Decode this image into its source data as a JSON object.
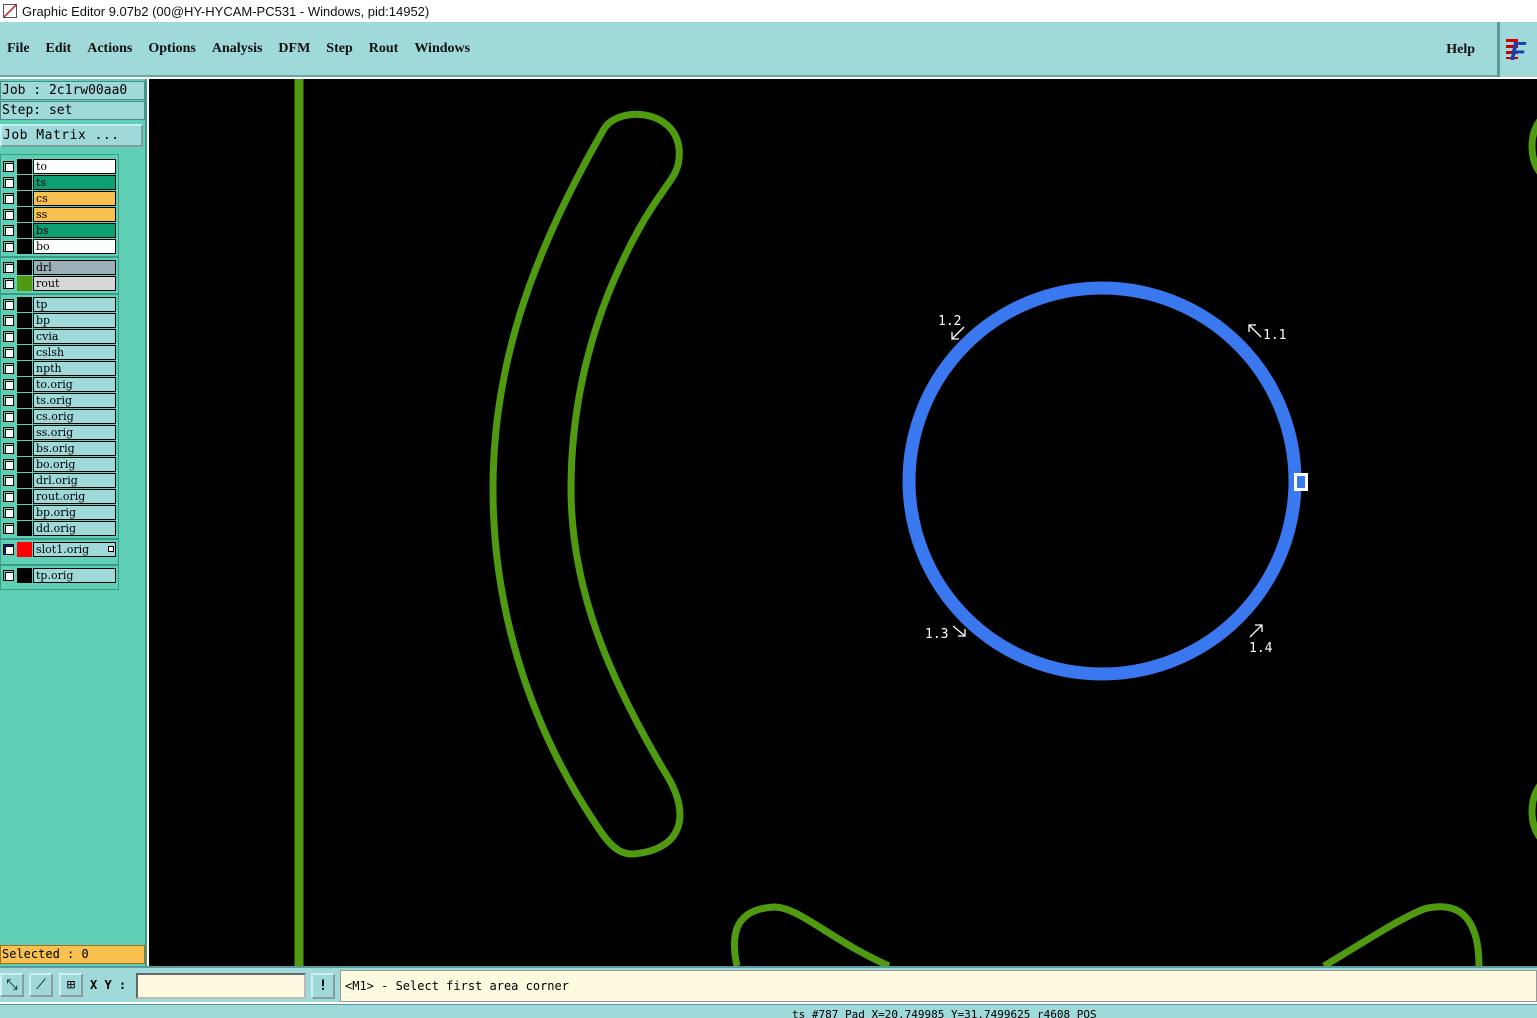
{
  "window": {
    "title": "Graphic Editor 9.07b2 (00@HY-HYCAM-PC531 - Windows, pid:14952)"
  },
  "menu": {
    "items": [
      "File",
      "Edit",
      "Actions",
      "Options",
      "Analysis",
      "DFM",
      "Step",
      "Rout",
      "Windows"
    ],
    "help": "Help"
  },
  "brand": {
    "logo_text": "F"
  },
  "job": {
    "job_line": "Job : 2c1rw00aa0",
    "step_line": "Step: set",
    "matrix_button": "Job Matrix ..."
  },
  "layers": [
    {
      "name": "to",
      "color": "#ffffff"
    },
    {
      "name": "ts",
      "color": "#0d9e72"
    },
    {
      "name": "cs",
      "color": "#f8c14f"
    },
    {
      "name": "ss",
      "color": "#f8c14f"
    },
    {
      "name": "bs",
      "color": "#0d9e72"
    },
    {
      "name": "bo",
      "color": "#ffffff"
    },
    {
      "name": "drl",
      "color": "#9cb0b8"
    },
    {
      "name": "rout",
      "color": "#d8d8d8",
      "swatch": "#4f9a10"
    },
    {
      "name": "tp",
      "color": "#9fd9d9"
    },
    {
      "name": "bp",
      "color": "#9fd9d9"
    },
    {
      "name": "cvia",
      "color": "#9fd9d9"
    },
    {
      "name": "cslsh",
      "color": "#9fd9d9"
    },
    {
      "name": "npth",
      "color": "#9fd9d9"
    },
    {
      "name": "to.orig",
      "color": "#9fd9d9"
    },
    {
      "name": "ts.orig",
      "color": "#9fd9d9"
    },
    {
      "name": "cs.orig",
      "color": "#9fd9d9"
    },
    {
      "name": "ss.orig",
      "color": "#9fd9d9"
    },
    {
      "name": "bs.orig",
      "color": "#9fd9d9"
    },
    {
      "name": "bo.orig",
      "color": "#9fd9d9"
    },
    {
      "name": "drl.orig",
      "color": "#9fd9d9"
    },
    {
      "name": "rout.orig",
      "color": "#9fd9d9"
    },
    {
      "name": "bp.orig",
      "color": "#9fd9d9"
    },
    {
      "name": "dd.orig",
      "color": "#9fd9d9"
    },
    {
      "name": "slot1.orig",
      "color": "#9fd9d9",
      "swatch": "#ff0000",
      "checkbox": "#0020a0",
      "has_indicator": true
    },
    {
      "name": "tp.orig",
      "color": "#9fd9d9"
    }
  ],
  "selection": {
    "label": "Selected : 0"
  },
  "canvas": {
    "background": "#000000",
    "rout_color": "#4f9a10",
    "circle_color": "#3a78f0",
    "labels": {
      "l11": "1.1",
      "l12": "1.2",
      "l13": "1.3",
      "l14": "1.4"
    }
  },
  "toolbar": {
    "xy_label": "X Y :",
    "xy_value": "",
    "warn_icon": "!",
    "prompt": "<M1> - Select first area corner"
  },
  "status": {
    "text": "ts #787 Pad X=20.749985 Y=31.7499625 r4608 POS"
  }
}
